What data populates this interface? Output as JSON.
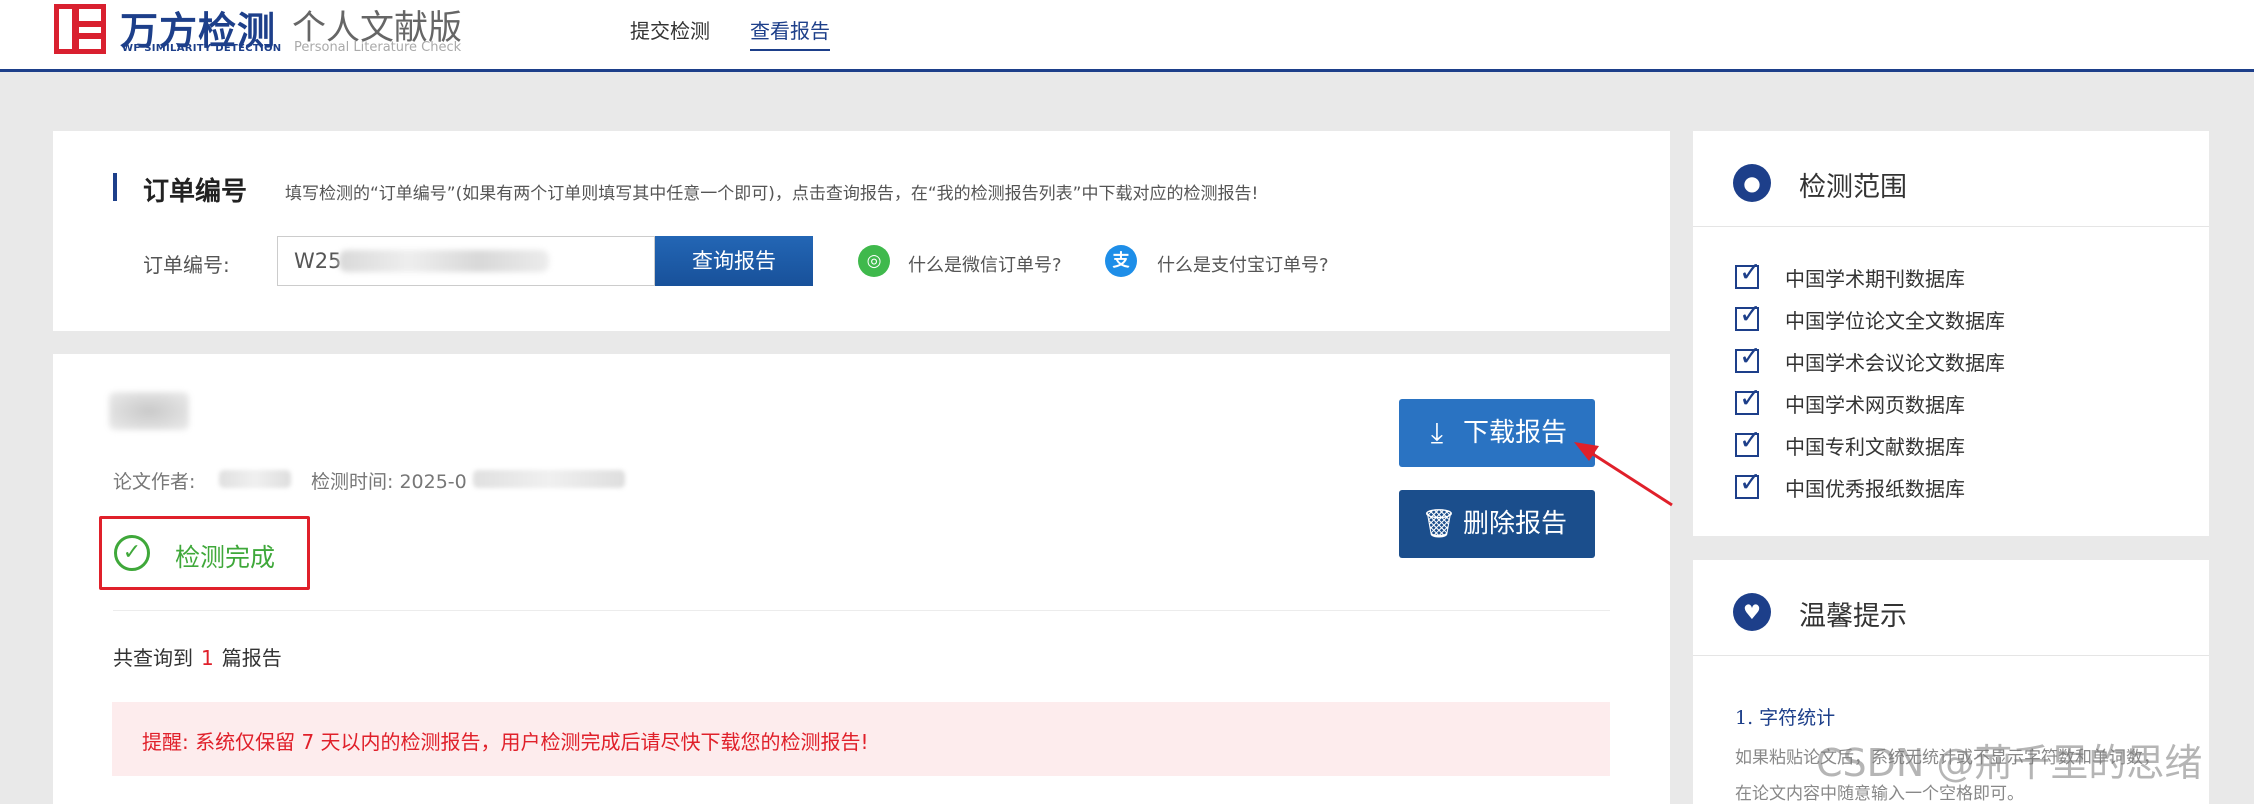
{
  "header": {
    "logo_title": "万方检测",
    "logo_subtitle": "WF SIMILARITY DETECTION",
    "edition": "个人文献版",
    "edition_en": "Personal Literature Check",
    "nav": [
      "提交检测",
      "查看报告"
    ],
    "active_nav": "查看报告"
  },
  "order": {
    "heading": "订单编号",
    "tip": "填写检测的“订单编号”(如果有两个订单则填写其中任意一个即可)，点击查询报告，在“我的检测报告列表”中下载对应的检测报告!",
    "field_label": "订单编号:",
    "field_value": "W25",
    "query_button": "查询报告",
    "wechat_help": "什么是微信订单号?",
    "alipay_help": "什么是支付宝订单号?"
  },
  "result": {
    "author_label": "论文作者:",
    "time_label": "检测时间: 2025-0",
    "status": "检测完成",
    "download_button": "下载报告",
    "delete_button": "删除报告",
    "count_prefix": "共查询到",
    "count_value": "1",
    "count_suffix": "篇报告",
    "warning": "提醒: 系统仅保留 7 天以内的检测报告，用户检测完成后请尽快下载您的检测报告!"
  },
  "scope": {
    "heading": "检测范围",
    "items": [
      "中国学术期刊数据库",
      "中国学位论文全文数据库",
      "中国学术会议论文数据库",
      "中国学术网页数据库",
      "中国专利文献数据库",
      "中国优秀报纸数据库"
    ]
  },
  "tips": {
    "heading": "温馨提示",
    "subheading": "1. 字符统计",
    "body": "如果粘贴论文后，系统无统计或不显示字符数和单词数，在论文内容中随意输入一个空格即可。"
  },
  "watermark": "CSDN @荊千里的思绪",
  "colors": {
    "brand_blue": "#1d3f8a",
    "accent_red": "#e0202a",
    "success_green": "#3fa83a",
    "download_blue": "#2a73c2"
  }
}
